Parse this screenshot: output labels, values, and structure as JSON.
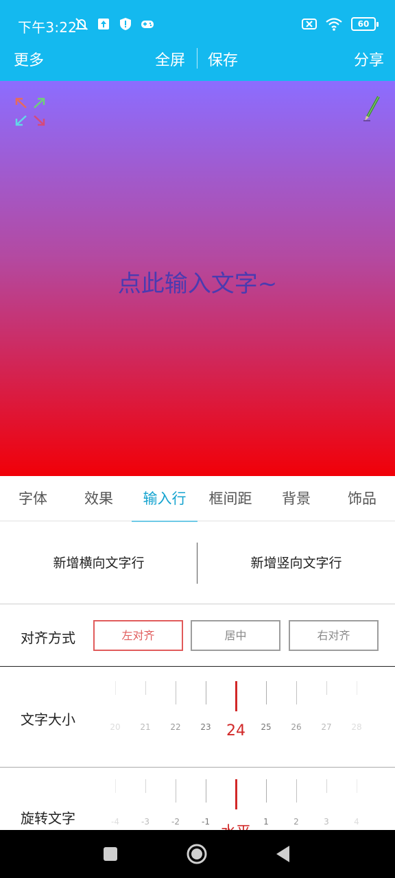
{
  "status": {
    "time": "下午3:22",
    "battery": "60",
    "left_icons": [
      "mute-icon",
      "upload-icon",
      "shield-icon",
      "gamepad-icon"
    ],
    "right_icons": [
      "sim-missing-icon",
      "wifi-icon",
      "battery-icon"
    ]
  },
  "toolbar": {
    "more": "更多",
    "fullscreen": "全屏",
    "save": "保存",
    "share": "分享"
  },
  "canvas": {
    "placeholder": "点此输入文字~",
    "gradient_top": "#8c6dff",
    "gradient_bottom": "#f10008",
    "text_color": "#4a3bb0"
  },
  "tabs": {
    "items": [
      {
        "label": "字体"
      },
      {
        "label": "效果"
      },
      {
        "label": "输入行"
      },
      {
        "label": "框间距"
      },
      {
        "label": "背景"
      },
      {
        "label": "饰品"
      }
    ],
    "active_index": 2
  },
  "add_line": {
    "horizontal": "新增横向文字行",
    "vertical": "新增竖向文字行"
  },
  "alignment": {
    "label": "对齐方式",
    "options": [
      "左对齐",
      "居中",
      "右对齐"
    ],
    "selected": "左对齐"
  },
  "font_size": {
    "label": "文字大小",
    "ticks": [
      "20",
      "21",
      "22",
      "23",
      "24",
      "25",
      "26",
      "27",
      "28"
    ],
    "current": "24"
  },
  "rotation": {
    "label": "旋转文字",
    "ticks": [
      "-4",
      "-3",
      "-2",
      "-1",
      "水平",
      "1",
      "2",
      "3",
      "4"
    ],
    "current": "水平"
  },
  "colors": {
    "accent": "#14b9ef",
    "active_tab": "#14a3cf",
    "selected": "#d12828"
  }
}
